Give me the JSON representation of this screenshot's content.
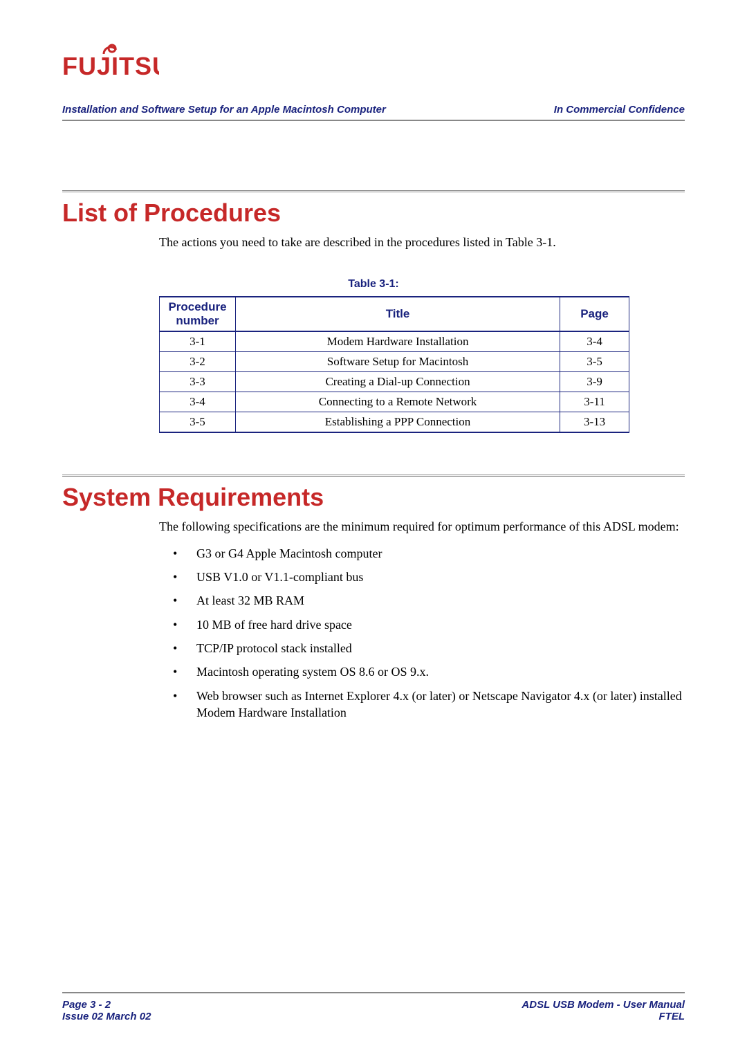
{
  "header": {
    "left": "Installation and Software Setup for an Apple Macintosh Computer",
    "right": "In Commercial Confidence"
  },
  "section1": {
    "heading": "List of Procedures",
    "intro": "The actions you need to take are described in the procedures listed in Table 3-1.",
    "table_caption": "Table 3-1:",
    "columns": {
      "proc": "Procedure number",
      "title": "Title",
      "page": "Page"
    },
    "rows": [
      {
        "proc": "3-1",
        "title": "Modem Hardware Installation",
        "page": "3-4"
      },
      {
        "proc": "3-2",
        "title": "Software Setup for Macintosh",
        "page": "3-5"
      },
      {
        "proc": "3-3",
        "title": "Creating a Dial-up Connection",
        "page": "3-9"
      },
      {
        "proc": "3-4",
        "title": "Connecting to a Remote Network",
        "page": "3-11"
      },
      {
        "proc": "3-5",
        "title": "Establishing a PPP Connection",
        "page": "3-13"
      }
    ]
  },
  "section2": {
    "heading": "System Requirements",
    "intro": "The following specifications are the minimum required for optimum performance of this ADSL modem:",
    "bullets": [
      "G3 or G4 Apple Macintosh computer",
      "USB V1.0 or V1.1-compliant bus",
      "At least 32 MB RAM",
      "10 MB of free hard drive space",
      "TCP/IP protocol stack installed",
      "Macintosh operating system OS 8.6 or OS 9.x.",
      "Web browser such as Internet Explorer 4.x (or later) or Netscape Navigator 4.x (or later) installed Modem Hardware Installation"
    ]
  },
  "footer": {
    "left_top": "Page 3 - 2",
    "left_bottom": "Issue 02 March 02",
    "right_top": "ADSL USB Modem - User Manual",
    "right_bottom": "FTEL"
  }
}
